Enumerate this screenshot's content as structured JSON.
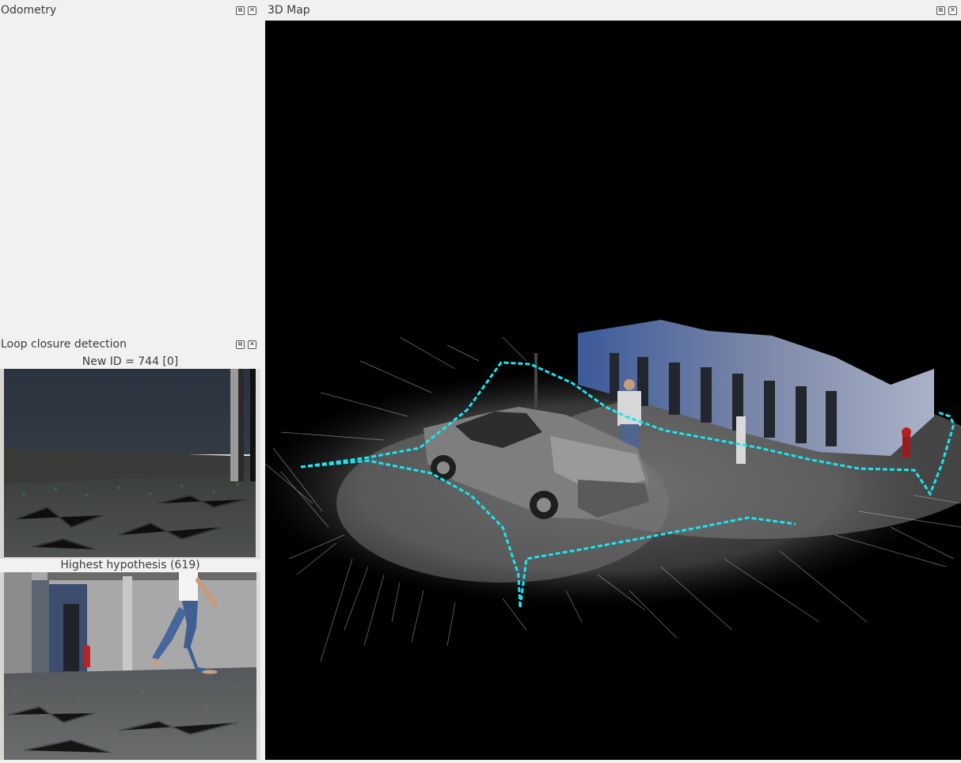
{
  "odometry": {
    "title": "Odometry"
  },
  "loop_closure": {
    "title": "Loop closure detection",
    "new_id_label": "New ID = 744 [0]",
    "hypothesis_label": "Highest hypothesis (619)"
  },
  "map3d": {
    "title": "3D Map"
  },
  "dock_buttons": {
    "float_glyph": "⧉",
    "close_glyph": "✕"
  },
  "colors": {
    "background": "#f2f1f0",
    "map_background": "#000000",
    "graph_path": "#19e6f0",
    "point_cloud": "#bbbbbb"
  }
}
